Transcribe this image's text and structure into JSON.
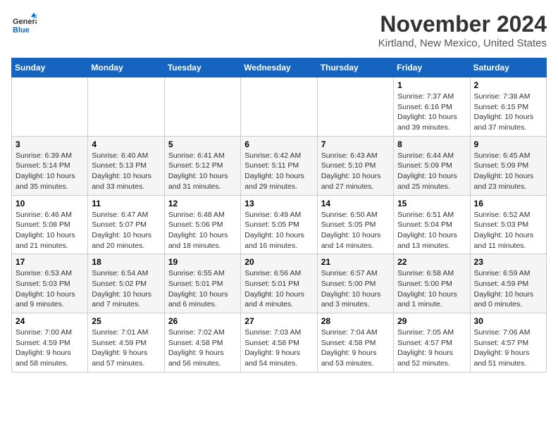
{
  "header": {
    "logo_line1": "General",
    "logo_line2": "Blue",
    "month": "November 2024",
    "location": "Kirtland, New Mexico, United States"
  },
  "weekdays": [
    "Sunday",
    "Monday",
    "Tuesday",
    "Wednesday",
    "Thursday",
    "Friday",
    "Saturday"
  ],
  "weeks": [
    [
      {
        "day": "",
        "info": ""
      },
      {
        "day": "",
        "info": ""
      },
      {
        "day": "",
        "info": ""
      },
      {
        "day": "",
        "info": ""
      },
      {
        "day": "",
        "info": ""
      },
      {
        "day": "1",
        "info": "Sunrise: 7:37 AM\nSunset: 6:16 PM\nDaylight: 10 hours and 39 minutes."
      },
      {
        "day": "2",
        "info": "Sunrise: 7:38 AM\nSunset: 6:15 PM\nDaylight: 10 hours and 37 minutes."
      }
    ],
    [
      {
        "day": "3",
        "info": "Sunrise: 6:39 AM\nSunset: 5:14 PM\nDaylight: 10 hours and 35 minutes."
      },
      {
        "day": "4",
        "info": "Sunrise: 6:40 AM\nSunset: 5:13 PM\nDaylight: 10 hours and 33 minutes."
      },
      {
        "day": "5",
        "info": "Sunrise: 6:41 AM\nSunset: 5:12 PM\nDaylight: 10 hours and 31 minutes."
      },
      {
        "day": "6",
        "info": "Sunrise: 6:42 AM\nSunset: 5:11 PM\nDaylight: 10 hours and 29 minutes."
      },
      {
        "day": "7",
        "info": "Sunrise: 6:43 AM\nSunset: 5:10 PM\nDaylight: 10 hours and 27 minutes."
      },
      {
        "day": "8",
        "info": "Sunrise: 6:44 AM\nSunset: 5:09 PM\nDaylight: 10 hours and 25 minutes."
      },
      {
        "day": "9",
        "info": "Sunrise: 6:45 AM\nSunset: 5:09 PM\nDaylight: 10 hours and 23 minutes."
      }
    ],
    [
      {
        "day": "10",
        "info": "Sunrise: 6:46 AM\nSunset: 5:08 PM\nDaylight: 10 hours and 21 minutes."
      },
      {
        "day": "11",
        "info": "Sunrise: 6:47 AM\nSunset: 5:07 PM\nDaylight: 10 hours and 20 minutes."
      },
      {
        "day": "12",
        "info": "Sunrise: 6:48 AM\nSunset: 5:06 PM\nDaylight: 10 hours and 18 minutes."
      },
      {
        "day": "13",
        "info": "Sunrise: 6:49 AM\nSunset: 5:05 PM\nDaylight: 10 hours and 16 minutes."
      },
      {
        "day": "14",
        "info": "Sunrise: 6:50 AM\nSunset: 5:05 PM\nDaylight: 10 hours and 14 minutes."
      },
      {
        "day": "15",
        "info": "Sunrise: 6:51 AM\nSunset: 5:04 PM\nDaylight: 10 hours and 13 minutes."
      },
      {
        "day": "16",
        "info": "Sunrise: 6:52 AM\nSunset: 5:03 PM\nDaylight: 10 hours and 11 minutes."
      }
    ],
    [
      {
        "day": "17",
        "info": "Sunrise: 6:53 AM\nSunset: 5:03 PM\nDaylight: 10 hours and 9 minutes."
      },
      {
        "day": "18",
        "info": "Sunrise: 6:54 AM\nSunset: 5:02 PM\nDaylight: 10 hours and 7 minutes."
      },
      {
        "day": "19",
        "info": "Sunrise: 6:55 AM\nSunset: 5:01 PM\nDaylight: 10 hours and 6 minutes."
      },
      {
        "day": "20",
        "info": "Sunrise: 6:56 AM\nSunset: 5:01 PM\nDaylight: 10 hours and 4 minutes."
      },
      {
        "day": "21",
        "info": "Sunrise: 6:57 AM\nSunset: 5:00 PM\nDaylight: 10 hours and 3 minutes."
      },
      {
        "day": "22",
        "info": "Sunrise: 6:58 AM\nSunset: 5:00 PM\nDaylight: 10 hours and 1 minute."
      },
      {
        "day": "23",
        "info": "Sunrise: 6:59 AM\nSunset: 4:59 PM\nDaylight: 10 hours and 0 minutes."
      }
    ],
    [
      {
        "day": "24",
        "info": "Sunrise: 7:00 AM\nSunset: 4:59 PM\nDaylight: 9 hours and 58 minutes."
      },
      {
        "day": "25",
        "info": "Sunrise: 7:01 AM\nSunset: 4:59 PM\nDaylight: 9 hours and 57 minutes."
      },
      {
        "day": "26",
        "info": "Sunrise: 7:02 AM\nSunset: 4:58 PM\nDaylight: 9 hours and 56 minutes."
      },
      {
        "day": "27",
        "info": "Sunrise: 7:03 AM\nSunset: 4:58 PM\nDaylight: 9 hours and 54 minutes."
      },
      {
        "day": "28",
        "info": "Sunrise: 7:04 AM\nSunset: 4:58 PM\nDaylight: 9 hours and 53 minutes."
      },
      {
        "day": "29",
        "info": "Sunrise: 7:05 AM\nSunset: 4:57 PM\nDaylight: 9 hours and 52 minutes."
      },
      {
        "day": "30",
        "info": "Sunrise: 7:06 AM\nSunset: 4:57 PM\nDaylight: 9 hours and 51 minutes."
      }
    ]
  ]
}
